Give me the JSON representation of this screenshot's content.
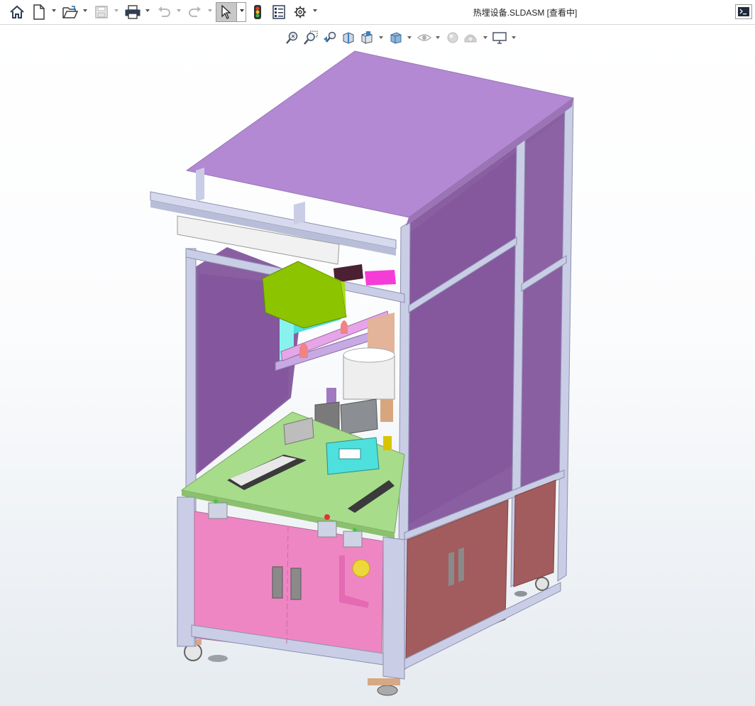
{
  "window": {
    "document_title": "热埋设备.SLDASM [查看中]"
  },
  "toolbar": {
    "buttons": [
      {
        "icon": "home-icon"
      },
      {
        "icon": "new-document-icon",
        "has_menu": true
      },
      {
        "icon": "open-folder-icon",
        "has_menu": true
      },
      {
        "icon": "save-icon",
        "has_menu": true,
        "disabled": true
      },
      {
        "icon": "print-icon",
        "has_menu": true
      },
      {
        "icon": "undo-icon",
        "has_menu": true,
        "disabled": true
      },
      {
        "icon": "redo-icon",
        "has_menu": true,
        "disabled": true
      },
      {
        "icon": "select-cursor-icon",
        "has_menu": true,
        "active": true
      },
      {
        "icon": "rebuild-traffic-light-icon"
      },
      {
        "icon": "file-properties-icon"
      },
      {
        "icon": "options-gear-icon",
        "has_menu": true
      }
    ],
    "command_prompt_icon": "command-prompt-icon"
  },
  "heads_up_toolbar": {
    "buttons": [
      {
        "icon": "zoom-to-fit-icon"
      },
      {
        "icon": "zoom-to-area-icon"
      },
      {
        "icon": "previous-view-icon"
      },
      {
        "icon": "section-view-icon"
      },
      {
        "icon": "view-orientation-icon",
        "has_menu": true
      },
      {
        "icon": "display-style-icon",
        "has_menu": true
      },
      {
        "icon": "hide-show-items-icon",
        "has_menu": true
      },
      {
        "icon": "edit-appearance-icon",
        "has_menu": true
      },
      {
        "icon": "apply-scene-icon",
        "has_menu": true
      },
      {
        "icon": "view-settings-monitor-icon",
        "has_menu": true
      }
    ]
  },
  "colors": {
    "cabinet_panel": "#8a5fa2",
    "roof": "#b389d3",
    "door_front": "#ef86c4",
    "door_side": "#a25c5e",
    "frame": "#c9cde6",
    "deck_plate": "#a7dc8a",
    "gantry_block": "#8cc400",
    "cyan_part": "#4de0dd",
    "toolbar_active": "#c8c8c8"
  }
}
